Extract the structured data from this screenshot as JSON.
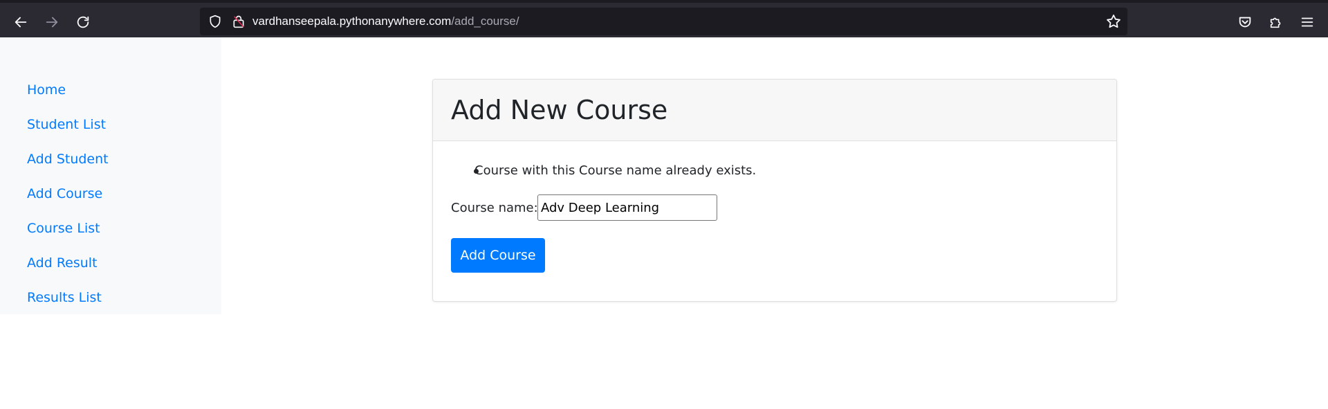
{
  "browser": {
    "url_host": "vardhanseepala.pythonanywhere.com",
    "url_path": "/add_course/",
    "icons": {
      "back": "arrow-left-icon",
      "forward": "arrow-right-icon",
      "reload": "reload-icon",
      "tracking": "shield-icon",
      "lock": "lock-icon",
      "bookmark": "star-icon",
      "pocket": "pocket-icon",
      "extensions": "puzzle-icon",
      "menu": "hamburger-menu-icon"
    }
  },
  "sidebar": {
    "items": [
      {
        "label": "Home"
      },
      {
        "label": "Student List"
      },
      {
        "label": "Add Student"
      },
      {
        "label": "Add Course"
      },
      {
        "label": "Course List"
      },
      {
        "label": "Add Result"
      },
      {
        "label": "Results List"
      }
    ]
  },
  "card": {
    "title": "Add New Course",
    "errors": [
      "Course with this Course name already exists."
    ],
    "field_label": "Course name:",
    "field_value": "Adv Deep Learning",
    "submit_label": "Add Course"
  },
  "colors": {
    "link": "#007bff",
    "primary_button": "#007bff",
    "toolbar_bg": "#2b2a33",
    "urlbar_bg": "#1c1b22",
    "sidebar_bg": "#f8f9fa",
    "card_header_bg": "#f7f7f7"
  }
}
